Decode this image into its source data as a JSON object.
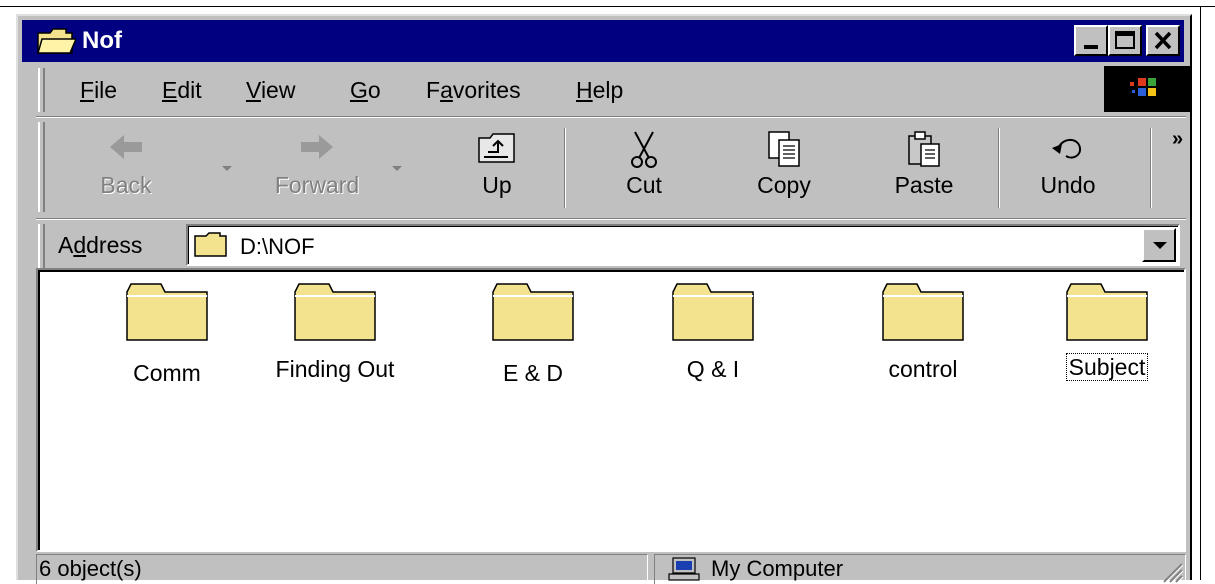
{
  "window": {
    "title": "Nof"
  },
  "menu": {
    "items": [
      {
        "label": "File",
        "accel": "F",
        "rest": "ile"
      },
      {
        "label": "Edit",
        "accel": "E",
        "rest": "dit"
      },
      {
        "label": "View",
        "accel": "V",
        "rest": "iew"
      },
      {
        "label": "Go",
        "accel": "G",
        "rest": "o"
      },
      {
        "label": "Favorites",
        "pre": "F",
        "accel": "a",
        "rest": "vorites"
      },
      {
        "label": "Help",
        "accel": "H",
        "rest": "elp"
      }
    ]
  },
  "toolbar": {
    "back_label": "Back",
    "forward_label": "Forward",
    "up_label": "Up",
    "cut_label": "Cut",
    "copy_label": "Copy",
    "paste_label": "Paste",
    "undo_label": "Undo",
    "more_label": "»"
  },
  "address": {
    "label_pre": "A",
    "label_accel": "d",
    "label_rest": "dress",
    "value": "D:\\NOF"
  },
  "files": [
    {
      "name": "Comm",
      "icon": "folder-icon"
    },
    {
      "name": "Finding Out",
      "icon": "folder-icon"
    },
    {
      "name": "E & D",
      "icon": "folder-icon"
    },
    {
      "name": "Q & I",
      "icon": "folder-icon"
    },
    {
      "name": "control",
      "icon": "folder-icon"
    },
    {
      "name": "Subject",
      "icon": "folder-icon",
      "focused": true
    }
  ],
  "status": {
    "objects": "6 object(s)",
    "zone": "My Computer"
  },
  "colors": {
    "titlebar": "#000080",
    "face": "#c0c0c0",
    "folder": "#f3e38e"
  }
}
